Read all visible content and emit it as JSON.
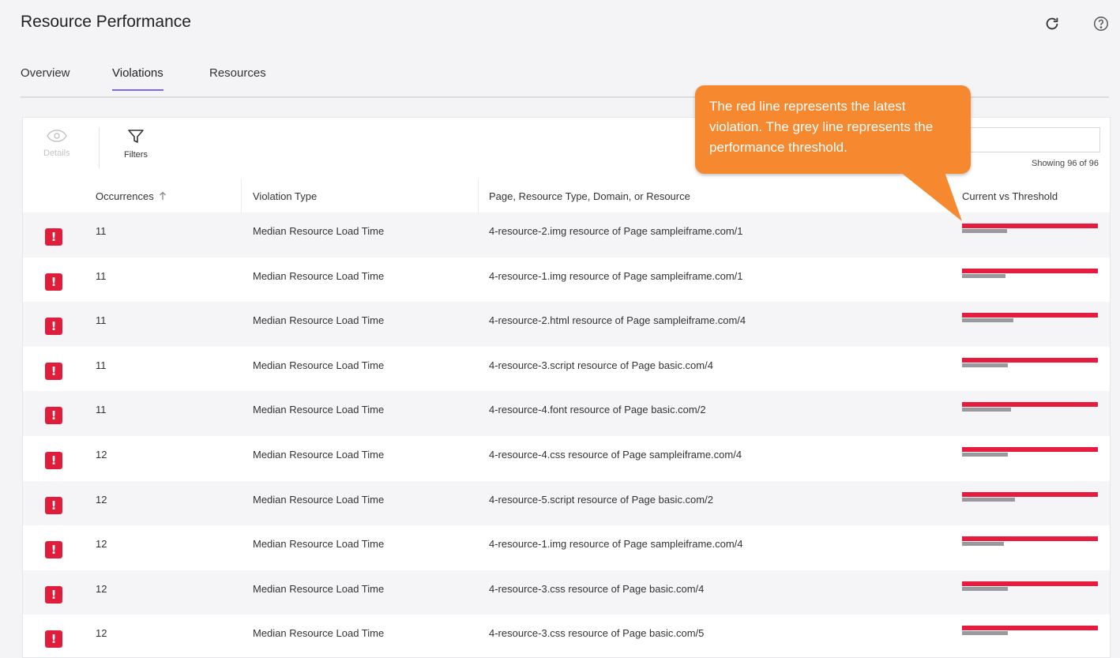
{
  "header": {
    "title": "Resource Performance",
    "refresh_icon": "refresh-icon",
    "help_icon": "help-icon"
  },
  "tabs": [
    {
      "label": "Overview",
      "active": false
    },
    {
      "label": "Violations",
      "active": true
    },
    {
      "label": "Resources",
      "active": false
    }
  ],
  "toolbar": {
    "details_label": "Details",
    "filters_label": "Filters",
    "showing": "Showing 96 of 96"
  },
  "table": {
    "columns": [
      "Occurrences",
      "Violation Type",
      "Page, Resource Type, Domain, or Resource",
      "Current vs Threshold"
    ],
    "sort_icon": "arrow-up-icon",
    "rows": [
      {
        "occurrences": "11",
        "type": "Median Resource Load Time",
        "resource": "4-resource-2.img resource of Page sampleiframe.com/1",
        "current": 1.0,
        "threshold": 0.33
      },
      {
        "occurrences": "11",
        "type": "Median Resource Load Time",
        "resource": "4-resource-1.img resource of Page sampleiframe.com/1",
        "current": 1.0,
        "threshold": 0.32
      },
      {
        "occurrences": "11",
        "type": "Median Resource Load Time",
        "resource": "4-resource-2.html resource of Page sampleiframe.com/4",
        "current": 1.0,
        "threshold": 0.38
      },
      {
        "occurrences": "11",
        "type": "Median Resource Load Time",
        "resource": "4-resource-3.script resource of Page basic.com/4",
        "current": 1.0,
        "threshold": 0.34
      },
      {
        "occurrences": "11",
        "type": "Median Resource Load Time",
        "resource": "4-resource-4.font resource of Page basic.com/2",
        "current": 1.0,
        "threshold": 0.36
      },
      {
        "occurrences": "12",
        "type": "Median Resource Load Time",
        "resource": "4-resource-4.css resource of Page sampleiframe.com/4",
        "current": 1.0,
        "threshold": 0.34
      },
      {
        "occurrences": "12",
        "type": "Median Resource Load Time",
        "resource": "4-resource-5.script resource of Page basic.com/2",
        "current": 1.0,
        "threshold": 0.39
      },
      {
        "occurrences": "12",
        "type": "Median Resource Load Time",
        "resource": "4-resource-1.img resource of Page sampleiframe.com/4",
        "current": 1.0,
        "threshold": 0.31
      },
      {
        "occurrences": "12",
        "type": "Median Resource Load Time",
        "resource": "4-resource-3.css resource of Page basic.com/4",
        "current": 1.0,
        "threshold": 0.34
      },
      {
        "occurrences": "12",
        "type": "Median Resource Load Time",
        "resource": "4-resource-3.css resource of Page basic.com/5",
        "current": 1.0,
        "threshold": 0.34
      }
    ]
  },
  "callout": {
    "text": "The red line represents the latest violation. The grey line represents the performance threshold."
  },
  "colors": {
    "accent": "#7b68ee",
    "violation_red": "#e51c3e",
    "threshold_grey": "#9a9a9e",
    "callout_orange": "#f6892f"
  }
}
